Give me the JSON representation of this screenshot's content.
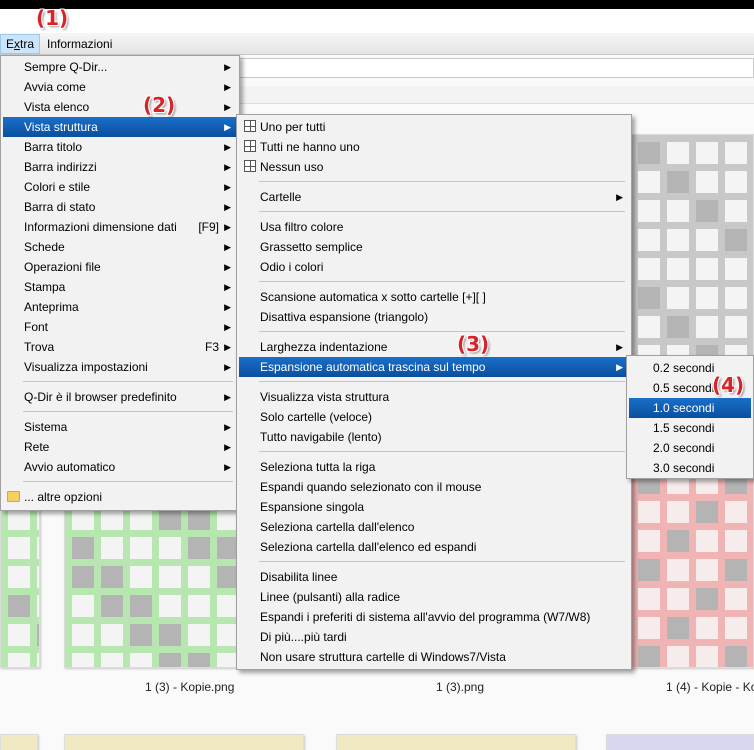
{
  "menubar": {
    "items": [
      {
        "label": "Extra",
        "underline": "x"
      },
      {
        "label": "Informazioni"
      }
    ]
  },
  "badges": [
    "(1)",
    "(2)",
    "(3)",
    "(4)"
  ],
  "extra_menu": [
    {
      "label": "Sempre Q-Dir...",
      "arrow": true
    },
    {
      "label": "Avvia come",
      "arrow": true
    },
    {
      "label": "Vista elenco",
      "arrow": true
    },
    {
      "label": "Vista struttura",
      "arrow": true,
      "highlight": true
    },
    {
      "label": "Barra titolo",
      "arrow": true
    },
    {
      "label": "Barra indirizzi",
      "arrow": true
    },
    {
      "label": "Colori e stile",
      "arrow": true
    },
    {
      "label": "Barra di stato",
      "arrow": true
    },
    {
      "label": "Informazioni dimensione dati",
      "shortcut": "[F9]",
      "arrow": true
    },
    {
      "label": "Schede",
      "arrow": true
    },
    {
      "label": "Operazioni file",
      "arrow": true
    },
    {
      "label": "Stampa",
      "arrow": true
    },
    {
      "label": "Anteprima",
      "arrow": true
    },
    {
      "label": "Font",
      "arrow": true
    },
    {
      "label": "Trova",
      "shortcut": "F3",
      "arrow": true
    },
    {
      "label": "Visualizza impostazioni",
      "arrow": true
    },
    {
      "separator": true
    },
    {
      "label": "Q-Dir è il browser predefinito",
      "arrow": true
    },
    {
      "separator": true
    },
    {
      "label": "Sistema",
      "arrow": true
    },
    {
      "label": "Rete",
      "arrow": true
    },
    {
      "label": "Avvio automatico",
      "arrow": true
    },
    {
      "separator": true
    },
    {
      "label": "... altre opzioni",
      "icon": "folder-icon"
    }
  ],
  "tree_menu": [
    {
      "label": "Uno per tutti",
      "icon": "grid-icon"
    },
    {
      "label": "Tutti ne hanno uno",
      "icon": "grid-icon"
    },
    {
      "label": "Nessun uso",
      "icon": "grid-icon"
    },
    {
      "separator": true
    },
    {
      "label": "Cartelle",
      "arrow": true
    },
    {
      "separator": true
    },
    {
      "label": "Usa filtro colore"
    },
    {
      "label": "Grassetto semplice"
    },
    {
      "label": "Odio i colori"
    },
    {
      "separator": true
    },
    {
      "label": "Scansione automatica x sotto cartelle [+][ ]"
    },
    {
      "label": "Disattiva espansione (triangolo)"
    },
    {
      "separator": true
    },
    {
      "label": "Larghezza indentazione",
      "arrow": true
    },
    {
      "label": "Espansione automatica trascina sul tempo",
      "arrow": true,
      "highlight": true
    },
    {
      "separator": true
    },
    {
      "label": "Visualizza vista struttura"
    },
    {
      "label": "Solo cartelle (veloce)"
    },
    {
      "label": "Tutto navigabile (lento)"
    },
    {
      "separator": true
    },
    {
      "label": "Seleziona tutta la riga"
    },
    {
      "label": "Espandi quando selezionato con il mouse"
    },
    {
      "label": "Espansione singola"
    },
    {
      "label": "Seleziona cartella dall'elenco"
    },
    {
      "label": "Seleziona cartella dall'elenco ed espandi"
    },
    {
      "separator": true
    },
    {
      "label": "Disabilita linee"
    },
    {
      "label": "Linee (pulsanti) alla radice"
    },
    {
      "label": "Espandi i preferiti di sistema all'avvio del programma (W7/W8)"
    },
    {
      "label": "Di più....più tardi"
    },
    {
      "label": "Non usare struttura cartelle di Windows7/Vista"
    }
  ],
  "time_menu": [
    {
      "label": "0.2 secondi"
    },
    {
      "label": "0.5 secondi"
    },
    {
      "label": "1.0 secondi",
      "highlight": true
    },
    {
      "label": "1.5 secondi"
    },
    {
      "label": "2.0 secondi"
    },
    {
      "label": "3.0 secondi"
    }
  ],
  "files": [
    "1 (3) - Kopie.png",
    "1 (3).png",
    "1 (4) - Kopie - Ko"
  ],
  "colors": {
    "highlight": "#0b5cad",
    "thumb_green": "#b8e6b0",
    "thumb_gray": "#c8c8c8",
    "thumb_red": "#f0b4b4",
    "badge": "#d8232a"
  }
}
